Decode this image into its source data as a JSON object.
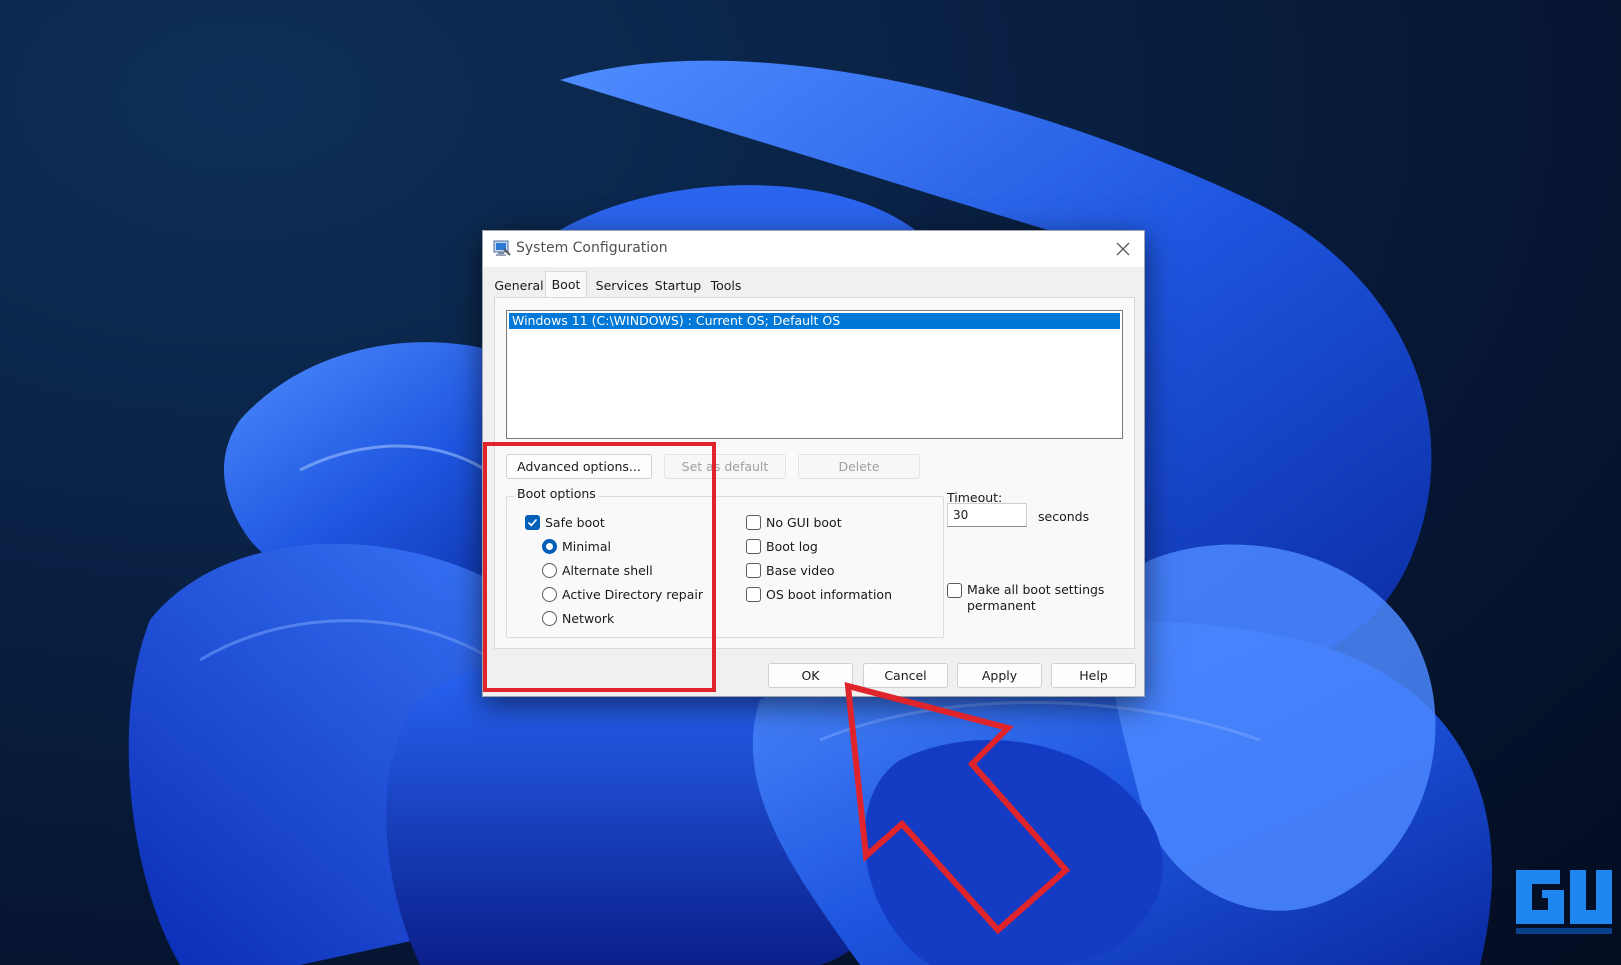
{
  "window": {
    "title": "System Configuration",
    "tabs": [
      {
        "label": "General"
      },
      {
        "label": "Boot"
      },
      {
        "label": "Services"
      },
      {
        "label": "Startup"
      },
      {
        "label": "Tools"
      }
    ],
    "active_tab": "Boot"
  },
  "boot": {
    "os_list": [
      "Windows 11 (C:\\WINDOWS) : Current OS; Default OS"
    ],
    "buttons": {
      "advanced": "Advanced options...",
      "set_default": "Set as default",
      "delete": "Delete"
    },
    "boot_options_label": "Boot options",
    "safe_boot": {
      "label": "Safe boot",
      "checked": true
    },
    "safe_boot_modes": [
      {
        "label": "Minimal",
        "selected": true
      },
      {
        "label": "Alternate shell",
        "selected": false
      },
      {
        "label": "Active Directory repair",
        "selected": false
      },
      {
        "label": "Network",
        "selected": false
      }
    ],
    "other_options": [
      {
        "label": "No GUI boot",
        "checked": false
      },
      {
        "label": "Boot log",
        "checked": false
      },
      {
        "label": "Base video",
        "checked": false
      },
      {
        "label": "OS boot information",
        "checked": false
      }
    ],
    "timeout": {
      "label": "Timeout:",
      "value": "30",
      "unit": "seconds"
    },
    "make_permanent": {
      "line1": "Make all boot settings",
      "line2": "permanent",
      "checked": false
    }
  },
  "footer": {
    "ok": "OK",
    "cancel": "Cancel",
    "apply": "Apply",
    "help": "Help"
  },
  "colors": {
    "selection": "#0078d7",
    "checkbox_accent": "#005fb8",
    "annotation_red": "#e0242c",
    "wallpaper_blue": "#1e56e0"
  },
  "icons": {
    "app": "system-configuration-icon",
    "close": "close-icon",
    "check": "checkmark-icon",
    "watermark": "gadgets-to-use-logo"
  }
}
